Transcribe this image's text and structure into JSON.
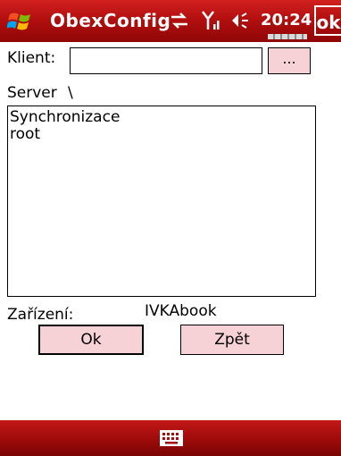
{
  "titlebar": {
    "app_title": "ObexConfig",
    "clock": "20:24",
    "ok_label": "ok"
  },
  "form": {
    "client_label": "Klient:",
    "client_value": "",
    "browse_label": "...",
    "server_label": "Server",
    "server_path": "\\",
    "server_items": [
      "Synchronizace",
      "root"
    ],
    "device_label": "Zařízení:",
    "device_value": "IVKAbook",
    "ok_button": "Ok",
    "back_button": "Zpět"
  },
  "colors": {
    "titlebar_red": "#b30f0f",
    "button_pink": "#f6d1d6"
  },
  "icons": [
    "windows-start-icon",
    "connectivity-icon",
    "signal-icon",
    "volume-icon",
    "battery-icon",
    "keyboard-icon"
  ]
}
